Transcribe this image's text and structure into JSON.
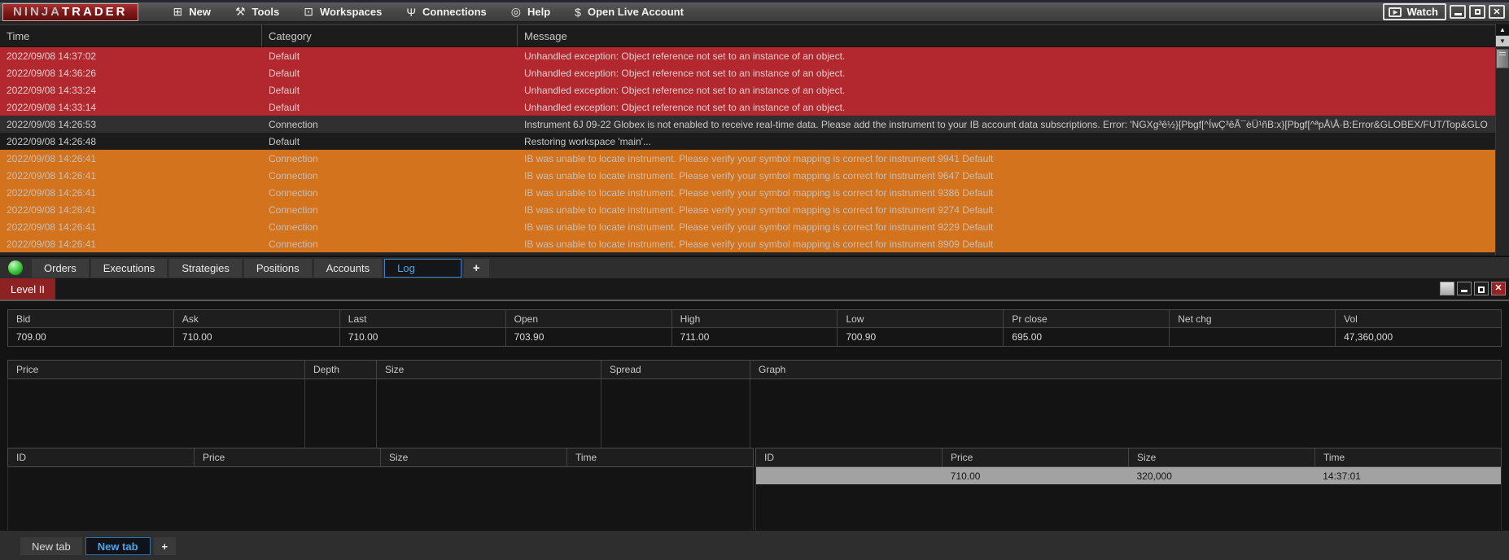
{
  "menubar": {
    "brand": {
      "part1": "NINJA",
      "part2": "TRADER"
    },
    "items": [
      {
        "label": "New",
        "icon": "new-icon"
      },
      {
        "label": "Tools",
        "icon": "tools-icon"
      },
      {
        "label": "Workspaces",
        "icon": "workspaces-icon"
      },
      {
        "label": "Connections",
        "icon": "connections-icon"
      },
      {
        "label": "Help",
        "icon": "help-icon"
      },
      {
        "label": "Open Live Account",
        "icon": "dollar-icon"
      }
    ],
    "watch_label": "Watch"
  },
  "log": {
    "columns": [
      "Time",
      "Category",
      "Message"
    ],
    "rows": [
      {
        "time": "2022/09/08 14:37:02",
        "category": "Default",
        "severity": "error",
        "message": "Unhandled exception: Object reference not set to an instance of an object."
      },
      {
        "time": "2022/09/08 14:36:26",
        "category": "Default",
        "severity": "error",
        "message": "Unhandled exception: Object reference not set to an instance of an object."
      },
      {
        "time": "2022/09/08 14:33:24",
        "category": "Default",
        "severity": "error",
        "message": "Unhandled exception: Object reference not set to an instance of an object."
      },
      {
        "time": "2022/09/08 14:33:14",
        "category": "Default",
        "severity": "error",
        "message": "Unhandled exception: Object reference not set to an instance of an object."
      },
      {
        "time": "2022/09/08 14:26:53",
        "category": "Connection",
        "severity": "notice",
        "message": "Instrument 6J 09-22 Globex is not enabled to receive real-time data. Please add the instrument to your IB account data subscriptions. Error: 'NGXg³ê½}[Pbgf[^ÍwÇ³êÃ¯èÜ¹ñB:x}[Pbgf[^ªpÅ\\Å·B:Error&GLOBEX/FUT/Top&GLO"
      },
      {
        "time": "2022/09/08 14:26:48",
        "category": "Default",
        "severity": "info",
        "message": "Restoring workspace 'main'..."
      },
      {
        "time": "2022/09/08 14:26:41",
        "category": "Connection",
        "severity": "warning",
        "message": "IB was unable to locate instrument. Please verify your symbol mapping is correct for instrument 9941 Default"
      },
      {
        "time": "2022/09/08 14:26:41",
        "category": "Connection",
        "severity": "warning",
        "message": "IB was unable to locate instrument. Please verify your symbol mapping is correct for instrument 9647 Default"
      },
      {
        "time": "2022/09/08 14:26:41",
        "category": "Connection",
        "severity": "warning",
        "message": "IB was unable to locate instrument. Please verify your symbol mapping is correct for instrument 9386 Default"
      },
      {
        "time": "2022/09/08 14:26:41",
        "category": "Connection",
        "severity": "warning",
        "message": "IB was unable to locate instrument. Please verify your symbol mapping is correct for instrument 9274 Default"
      },
      {
        "time": "2022/09/08 14:26:41",
        "category": "Connection",
        "severity": "warning",
        "message": "IB was unable to locate instrument. Please verify your symbol mapping is correct for instrument 9229 Default"
      },
      {
        "time": "2022/09/08 14:26:41",
        "category": "Connection",
        "severity": "warning",
        "message": "IB was unable to locate instrument. Please verify your symbol mapping is correct for instrument 8909 Default"
      }
    ]
  },
  "panel_tabs": {
    "items": [
      {
        "label": "Orders",
        "active": false
      },
      {
        "label": "Executions",
        "active": false
      },
      {
        "label": "Strategies",
        "active": false
      },
      {
        "label": "Positions",
        "active": false
      },
      {
        "label": "Accounts",
        "active": false
      },
      {
        "label": "Log",
        "active": true
      }
    ],
    "add_label": "+"
  },
  "level2": {
    "title": "Level II",
    "quote": {
      "columns": [
        "Bid",
        "Ask",
        "Last",
        "Open",
        "High",
        "Low",
        "Pr close",
        "Net chg",
        "Vol"
      ],
      "values": [
        "709.00",
        "710.00",
        "710.00",
        "703.90",
        "711.00",
        "700.90",
        "695.00",
        "",
        "47,360,000"
      ]
    },
    "ladder_columns": [
      "Price",
      "Depth",
      "Size",
      "Spread",
      "Graph"
    ],
    "tns": {
      "columns": [
        "ID",
        "Price",
        "Size",
        "Time"
      ],
      "left_rows": [],
      "right_rows": [
        {
          "id": "",
          "price": "710.00",
          "size": "320,000",
          "time": "14:37:01"
        }
      ]
    },
    "bottom_tabs": {
      "items": [
        {
          "label": "New tab",
          "active": false
        },
        {
          "label": "New tab",
          "active": true
        }
      ],
      "add_label": "+"
    }
  },
  "colors": {
    "error_bg": "#b2282e",
    "warning_bg": "#d4731d",
    "accent_blue": "#57a4e0",
    "title_red": "#8e2222",
    "status_green": "#38c438",
    "highlight_row": "#a2a2a2"
  }
}
